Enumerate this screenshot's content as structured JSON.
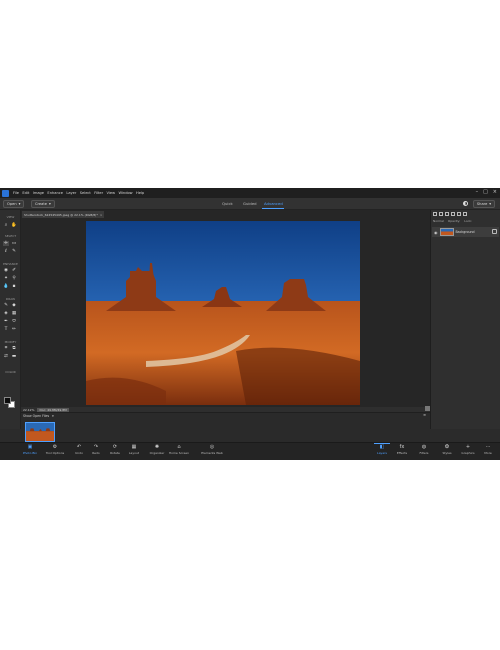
{
  "menubar": {
    "items": [
      "File",
      "Edit",
      "Image",
      "Enhance",
      "Layer",
      "Select",
      "Filter",
      "View",
      "Window",
      "Help"
    ]
  },
  "modebar": {
    "open_label": "Open",
    "create_label": "Create",
    "tabs": [
      "Quick",
      "Guided",
      "Advanced"
    ],
    "active_tab": "Advanced",
    "share_label": "Share"
  },
  "toolbox": {
    "sections": [
      "VIEW",
      "SELECT",
      "ENHANCE",
      "DRAW",
      "MODIFY",
      "COLOR"
    ]
  },
  "document": {
    "tab_title": "Shutterstock_624545495.jpeg @ 22.1% (RGB/8)*",
    "zoom": "22.12%",
    "info": "Doc: 49.8M/49.8M"
  },
  "layers": {
    "blend_mode": "Normal",
    "opacity_label": "Opacity:",
    "lock_label": "Lock:",
    "layer_name": "Background"
  },
  "photobin": {
    "header": "Show Open Files"
  },
  "taskbar": {
    "left": [
      {
        "label": "Photo Bin",
        "icon": "photo-bin-icon"
      },
      {
        "label": "Tool Options",
        "icon": "tool-options-icon"
      },
      {
        "label": "Undo",
        "icon": "undo-icon"
      },
      {
        "label": "Redo",
        "icon": "redo-icon"
      },
      {
        "label": "Rotate",
        "icon": "rotate-icon"
      },
      {
        "label": "Layout",
        "icon": "layout-icon"
      },
      {
        "label": "Organizer",
        "icon": "organizer-icon"
      },
      {
        "label": "Home Screen",
        "icon": "home-icon"
      },
      {
        "label": "Elements Web",
        "icon": "elements-web-icon"
      }
    ],
    "right": [
      {
        "label": "Layers",
        "icon": "layers-icon"
      },
      {
        "label": "Effects",
        "icon": "effects-icon"
      },
      {
        "label": "Filters",
        "icon": "filters-icon"
      },
      {
        "label": "Styles",
        "icon": "styles-icon"
      },
      {
        "label": "Graphics",
        "icon": "graphics-icon"
      },
      {
        "label": "More",
        "icon": "more-icon"
      }
    ],
    "active": "Layers"
  },
  "colors": {
    "accent": "#4ea0ff",
    "app_bg": "#2b2b2b"
  }
}
